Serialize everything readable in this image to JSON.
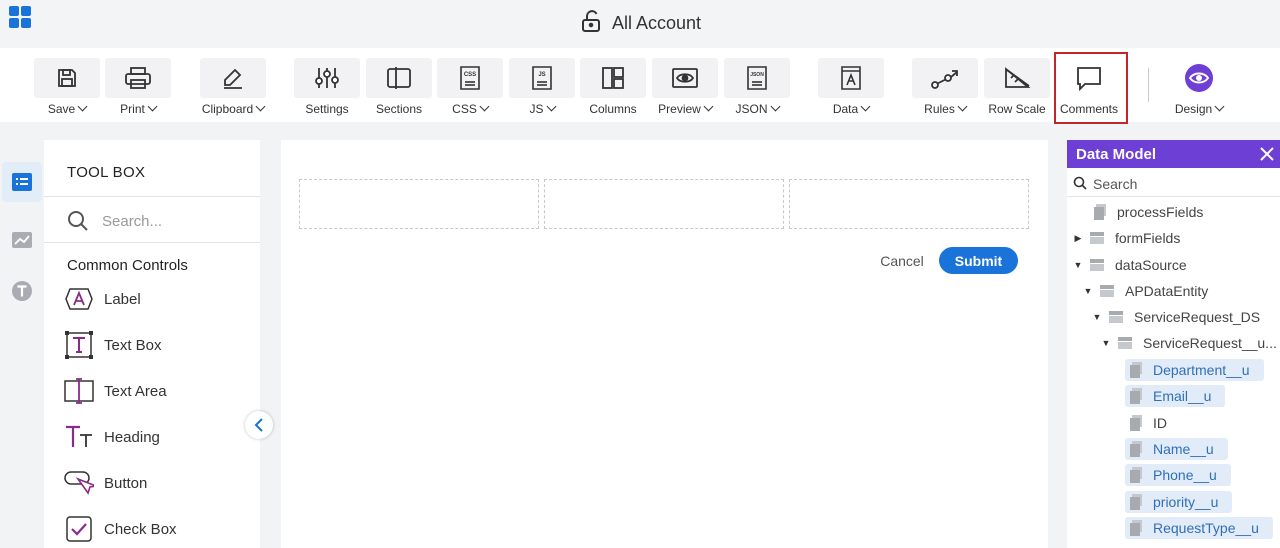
{
  "header": {
    "title": "All Account"
  },
  "toolbar": {
    "items": [
      {
        "label": "Save",
        "dropdown": true,
        "icon": "save-icon"
      },
      {
        "label": "Print",
        "dropdown": true,
        "icon": "print-icon"
      },
      {
        "label": "Clipboard",
        "dropdown": true,
        "icon": "clipboard-icon"
      },
      {
        "label": "Settings",
        "dropdown": false,
        "icon": "settings-icon"
      },
      {
        "label": "Sections",
        "dropdown": false,
        "icon": "sections-icon"
      },
      {
        "label": "CSS",
        "dropdown": true,
        "icon": "css-icon"
      },
      {
        "label": "JS",
        "dropdown": true,
        "icon": "js-icon"
      },
      {
        "label": "Columns",
        "dropdown": false,
        "icon": "columns-icon"
      },
      {
        "label": "Preview",
        "dropdown": true,
        "icon": "preview-icon"
      },
      {
        "label": "JSON",
        "dropdown": true,
        "icon": "json-icon"
      },
      {
        "label": "Data",
        "dropdown": true,
        "icon": "data-icon"
      },
      {
        "label": "Rules",
        "dropdown": true,
        "icon": "rules-icon"
      },
      {
        "label": "Row Scale",
        "dropdown": false,
        "icon": "row-scale-icon"
      },
      {
        "label": "Comments",
        "dropdown": false,
        "icon": "comments-icon",
        "highlighted": true
      },
      {
        "label": "Design",
        "dropdown": true,
        "icon": "eye-icon"
      }
    ],
    "icon_text": {
      "css": "CSS",
      "js": "JS",
      "json": "JSON"
    }
  },
  "toolbox": {
    "title": "TOOL BOX",
    "search_placeholder": "Search...",
    "section": "Common Controls",
    "items": [
      {
        "label": "Label",
        "icon": "label-icon"
      },
      {
        "label": "Text Box",
        "icon": "text-box-icon"
      },
      {
        "label": "Text Area",
        "icon": "text-area-icon"
      },
      {
        "label": "Heading",
        "icon": "heading-icon"
      },
      {
        "label": "Button",
        "icon": "button-icon"
      },
      {
        "label": "Check Box",
        "icon": "check-box-icon"
      }
    ]
  },
  "canvas": {
    "cancel_label": "Cancel",
    "submit_label": "Submit"
  },
  "data_model": {
    "title": "Data Model",
    "search_placeholder": "Search",
    "tree": [
      {
        "label": "processFields",
        "arrow": "",
        "type": "leaf",
        "highlight": false
      },
      {
        "label": "formFields",
        "arrow": "▶",
        "type": "group",
        "highlight": false
      },
      {
        "label": "dataSource",
        "arrow": "▼",
        "type": "group",
        "highlight": false
      },
      {
        "label": "APDataEntity",
        "arrow": "▼",
        "type": "group",
        "highlight": false
      },
      {
        "label": "ServiceRequest_DS",
        "arrow": "▼",
        "type": "group",
        "highlight": false
      },
      {
        "label": "ServiceRequest__u...",
        "arrow": "▼",
        "type": "group",
        "highlight": false
      },
      {
        "label": "Department__u",
        "arrow": "",
        "type": "leaf",
        "highlight": true
      },
      {
        "label": "Email__u",
        "arrow": "",
        "type": "leaf",
        "highlight": true
      },
      {
        "label": "ID",
        "arrow": "",
        "type": "leaf",
        "highlight": false
      },
      {
        "label": "Name__u",
        "arrow": "",
        "type": "leaf",
        "highlight": true
      },
      {
        "label": "Phone__u",
        "arrow": "",
        "type": "leaf",
        "highlight": true
      },
      {
        "label": "priority__u",
        "arrow": "",
        "type": "leaf",
        "highlight": true
      },
      {
        "label": "RequestType__u",
        "arrow": "",
        "type": "leaf",
        "highlight": true
      }
    ]
  },
  "colors": {
    "accent": "#1a73d9",
    "data_model_header": "#6d3fd4",
    "highlight_border": "#c0272d",
    "tool_icon": "#8a2a8a"
  }
}
